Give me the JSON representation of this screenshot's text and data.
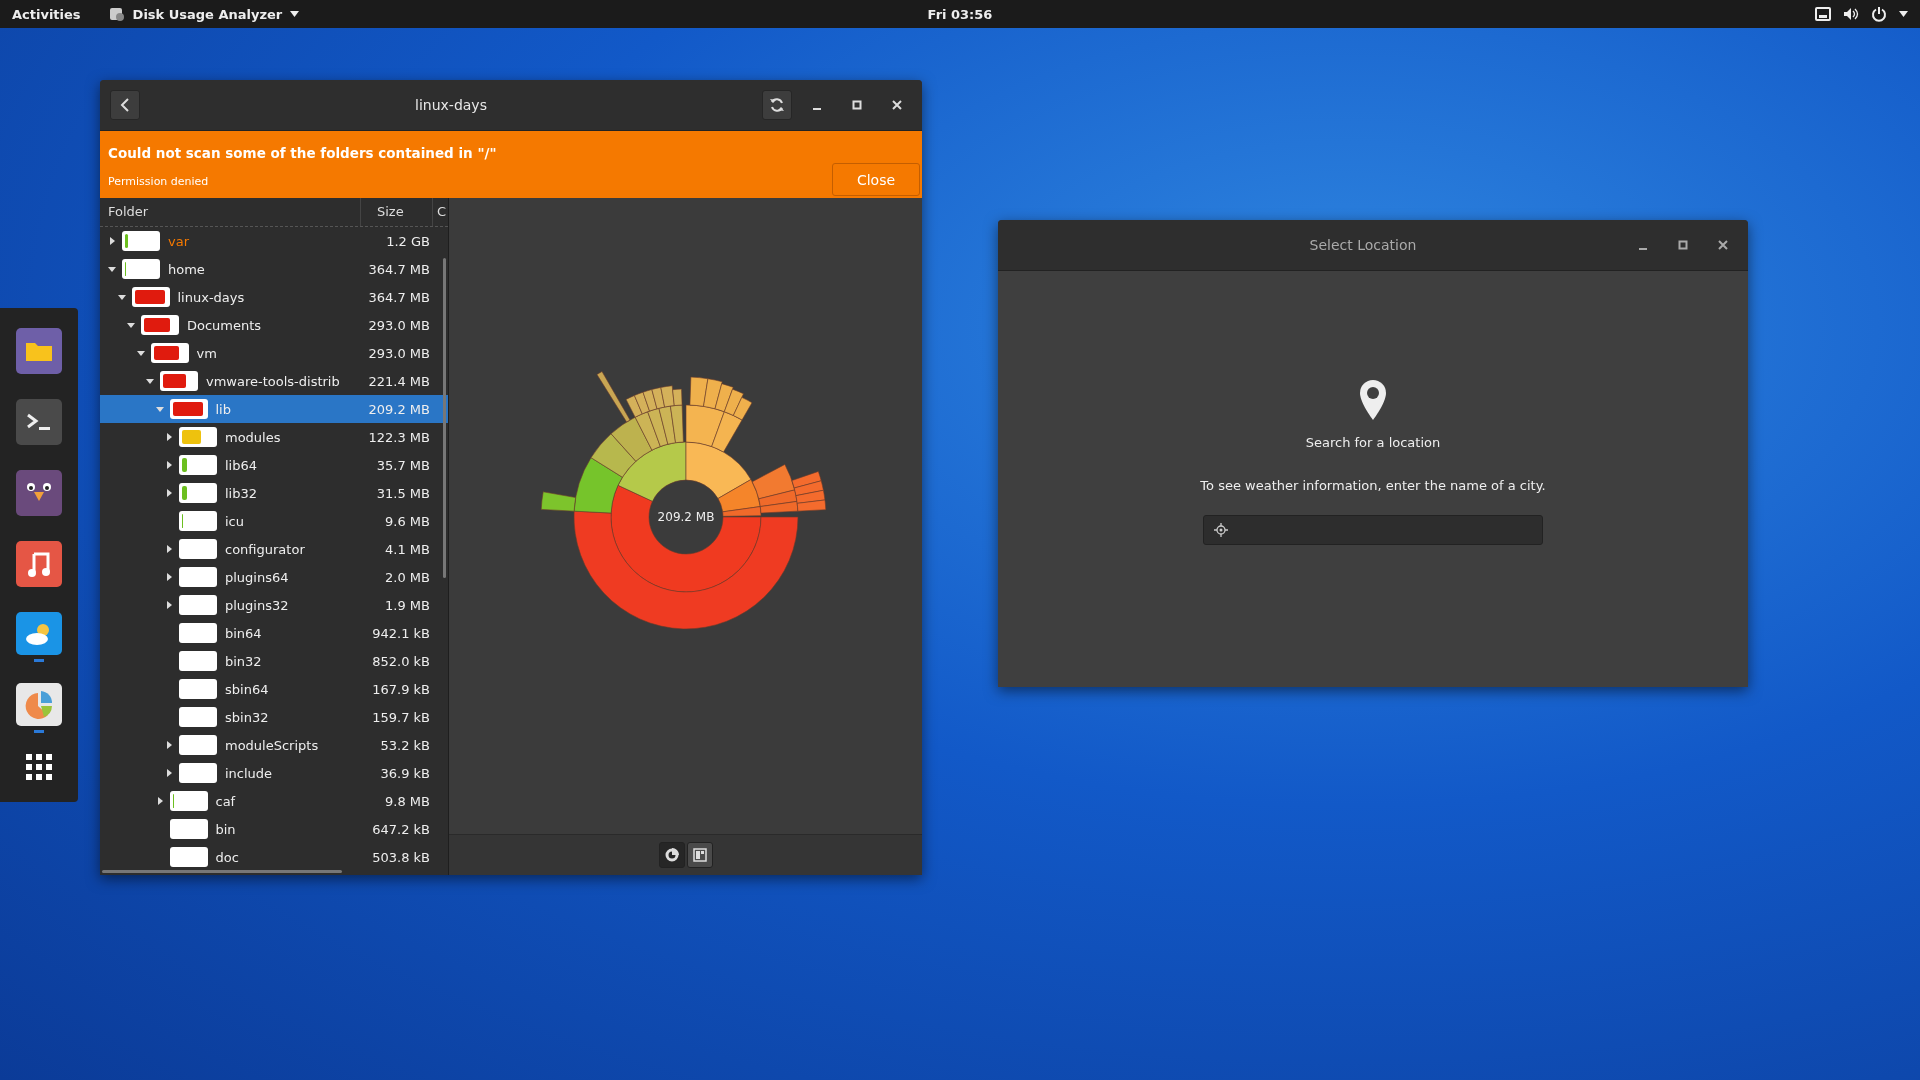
{
  "top_bar": {
    "activities": "Activities",
    "app_menu": "Disk Usage Analyzer",
    "clock": "Fri 03:56"
  },
  "dock": [
    {
      "kind": "files",
      "running": false
    },
    {
      "kind": "terminal",
      "running": false
    },
    {
      "kind": "chat",
      "running": false
    },
    {
      "kind": "music",
      "running": false
    },
    {
      "kind": "weather",
      "running": true
    },
    {
      "kind": "usage",
      "running": true
    }
  ],
  "main_window": {
    "title": "linux-days",
    "banner": {
      "message": "Could not scan some of the folders contained in \"/\"",
      "detail": "Permission denied",
      "button": "Close"
    },
    "columns": [
      "Folder",
      "Size",
      "C"
    ],
    "tree": [
      {
        "name": "var",
        "size": "1.2 GB",
        "expanded": false,
        "partial": true,
        "level": 0.1,
        "color": "#6cbf1f",
        "selected": false
      },
      {
        "name": "home",
        "size": "364.7 MB",
        "expanded": true,
        "partial": false,
        "level": 0.03,
        "color": "#6cbf1f",
        "selected": false,
        "children": [
          {
            "name": "linux-days",
            "size": "364.7 MB",
            "expanded": true,
            "partial": false,
            "level": 0.95,
            "color": "#e01b0e",
            "selected": false,
            "children": [
              {
                "name": "Documents",
                "size": "293.0 MB",
                "expanded": true,
                "partial": false,
                "level": 0.8,
                "color": "#e01b0e",
                "selected": false,
                "children": [
                  {
                    "name": "vm",
                    "size": "293.0 MB",
                    "expanded": true,
                    "partial": false,
                    "level": 0.8,
                    "color": "#e01b0e",
                    "selected": false,
                    "children": [
                      {
                        "name": "vmware-tools-distrib",
                        "size": "221.4 MB",
                        "expanded": true,
                        "partial": false,
                        "level": 0.72,
                        "color": "#e01b0e",
                        "selected": false,
                        "children": [
                          {
                            "name": "lib",
                            "size": "209.2 MB",
                            "expanded": true,
                            "partial": false,
                            "level": 0.95,
                            "color": "#e01b0e",
                            "selected": true,
                            "children": [
                              {
                                "name": "modules",
                                "size": "122.3 MB",
                                "expanded": false,
                                "partial": false,
                                "level": 0.58,
                                "color": "#eec20e",
                                "selected": false
                              },
                              {
                                "name": "lib64",
                                "size": "35.7 MB",
                                "expanded": false,
                                "partial": false,
                                "level": 0.17,
                                "color": "#6cbf1f",
                                "selected": false
                              },
                              {
                                "name": "lib32",
                                "size": "31.5 MB",
                                "expanded": false,
                                "partial": false,
                                "level": 0.15,
                                "color": "#6cbf1f",
                                "selected": false
                              },
                              {
                                "name": "icu",
                                "size": "9.6 MB",
                                "partial": false,
                                "level": 0.04,
                                "color": "#6cbf1f",
                                "selected": false
                              },
                              {
                                "name": "configurator",
                                "size": "4.1 MB",
                                "expanded": false,
                                "partial": false,
                                "selected": false
                              },
                              {
                                "name": "plugins64",
                                "size": "2.0 MB",
                                "expanded": false,
                                "partial": false,
                                "selected": false
                              },
                              {
                                "name": "plugins32",
                                "size": "1.9 MB",
                                "expanded": false,
                                "partial": false,
                                "selected": false
                              },
                              {
                                "name": "bin64",
                                "size": "942.1 kB",
                                "partial": false,
                                "selected": false
                              },
                              {
                                "name": "bin32",
                                "size": "852.0 kB",
                                "partial": false,
                                "selected": false
                              },
                              {
                                "name": "sbin64",
                                "size": "167.9 kB",
                                "partial": false,
                                "selected": false
                              },
                              {
                                "name": "sbin32",
                                "size": "159.7 kB",
                                "partial": false,
                                "selected": false
                              },
                              {
                                "name": "moduleScripts",
                                "size": "53.2 kB",
                                "expanded": false,
                                "partial": false,
                                "selected": false
                              },
                              {
                                "name": "include",
                                "size": "36.9 kB",
                                "expanded": false,
                                "partial": false,
                                "selected": false
                              }
                            ]
                          },
                          {
                            "name": "caf",
                            "size": "9.8 MB",
                            "expanded": false,
                            "partial": false,
                            "level": 0.04,
                            "color": "#6cbf1f",
                            "selected": false
                          },
                          {
                            "name": "bin",
                            "size": "647.2 kB",
                            "partial": false,
                            "selected": false
                          },
                          {
                            "name": "doc",
                            "size": "503.8 kB",
                            "partial": false,
                            "selected": false
                          }
                        ]
                      }
                    ]
                  }
                ]
              }
            ]
          }
        ]
      }
    ],
    "chart_center": "209.2 MB",
    "chart_switcher": [
      {
        "kind": "rings",
        "selected": true
      },
      {
        "kind": "treemap",
        "selected": false
      }
    ]
  },
  "location_window": {
    "title": "Select Location",
    "heading": "Search for a location",
    "hint": "To see weather information, enter the name of a city."
  }
}
